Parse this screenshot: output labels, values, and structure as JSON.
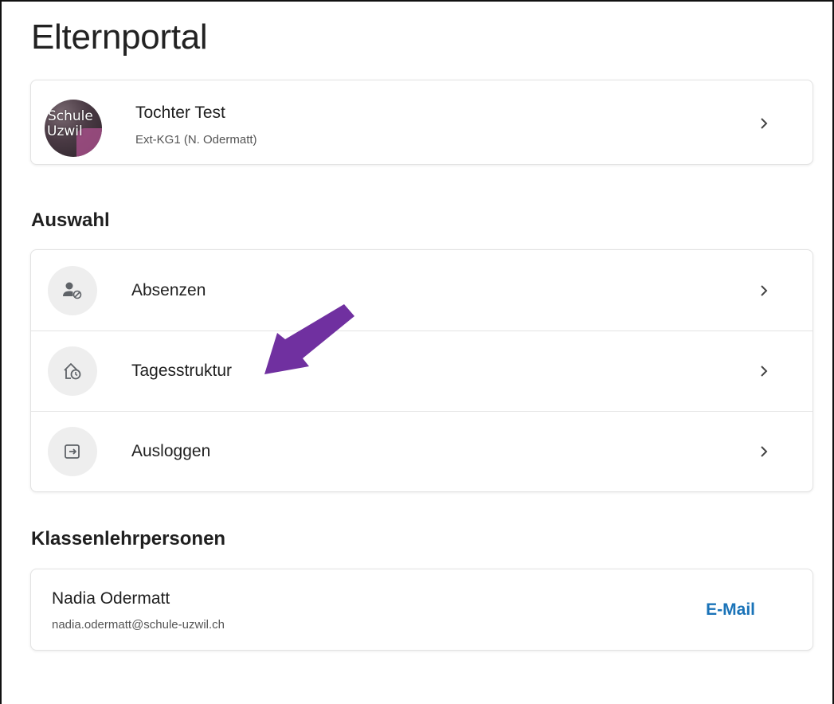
{
  "page": {
    "title": "Elternportal"
  },
  "child": {
    "name": "Tochter Test",
    "subtitle": "Ext-KG1 (N. Odermatt)",
    "avatar_text_line1": "Schule",
    "avatar_text_line2": "Uzwil"
  },
  "auswahl": {
    "heading": "Auswahl",
    "items": [
      {
        "label": "Absenzen",
        "icon": "person-blocked-icon"
      },
      {
        "label": "Tagesstruktur",
        "icon": "home-clock-icon"
      },
      {
        "label": "Ausloggen",
        "icon": "logout-icon"
      }
    ]
  },
  "teachers": {
    "heading": "Klassenlehrpersonen",
    "items": [
      {
        "name": "Nadia Odermatt",
        "email": "nadia.odermatt@schule-uzwil.ch",
        "action_label": "E-Mail"
      }
    ]
  },
  "colors": {
    "accent": "#1a73b8",
    "annotation_arrow": "#7030a0",
    "icon_bg": "#eeeeee",
    "icon_fg": "#5f6368"
  }
}
